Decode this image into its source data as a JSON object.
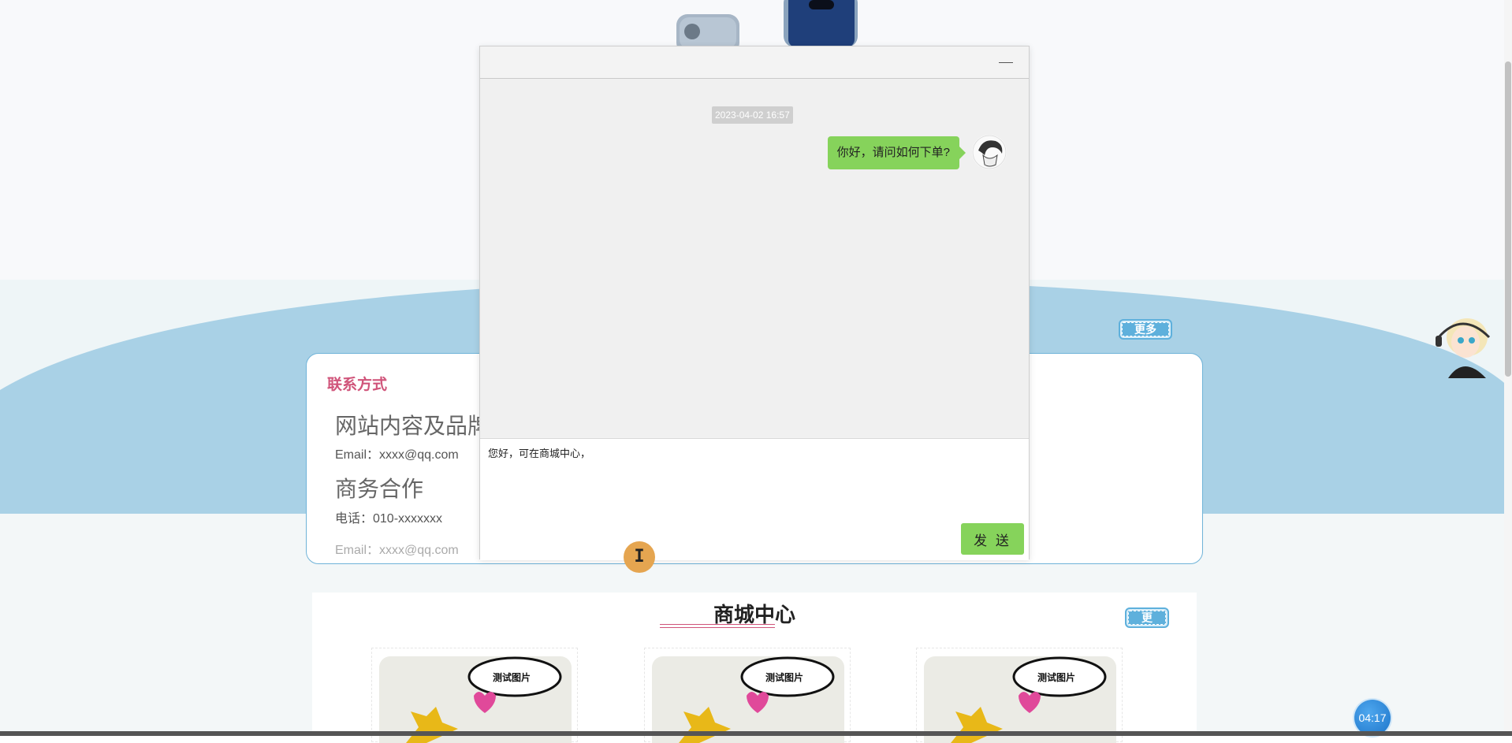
{
  "background": {
    "more_label_1": "更多",
    "more_label_2": "更多",
    "contact": {
      "title": "联系方式",
      "heading_1": "网站内容及品牌",
      "email_1": "Email：xxxx@qq.com",
      "heading_2": "商务合作",
      "phone": "电话：010-xxxxxxx",
      "email_2": "Email：xxxx@qq.com"
    },
    "mall": {
      "title": "商城中心",
      "products": [
        {
          "image_text": "测试图片"
        },
        {
          "image_text": "测试图片"
        },
        {
          "image_text": "测试图片"
        }
      ]
    },
    "timer": "04:17"
  },
  "chat": {
    "timestamp": "2023-04-02 16:57",
    "messages": [
      {
        "text": "你好，请问如何下单?"
      }
    ],
    "input_value": "您好，可在商城中心，",
    "send_label": "发 送",
    "cursor_glyph": "I"
  },
  "colors": {
    "accent_green": "#86d35b",
    "accent_blue": "#5eb0dc",
    "contact_title": "#d0547a"
  }
}
